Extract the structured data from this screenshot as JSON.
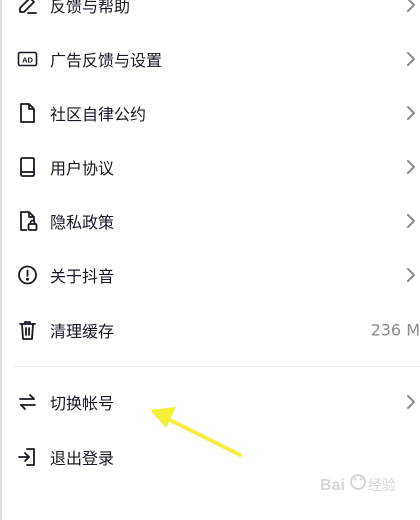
{
  "menu": {
    "items": [
      {
        "label": "反馈与帮助",
        "icon": "edit-icon"
      },
      {
        "label": "广告反馈与设置",
        "icon": "ad-icon"
      },
      {
        "label": "社区自律公约",
        "icon": "document-icon"
      },
      {
        "label": "用户协议",
        "icon": "book-icon"
      },
      {
        "label": "隐私政策",
        "icon": "lock-document-icon"
      },
      {
        "label": "关于抖音",
        "icon": "info-icon"
      },
      {
        "label": "清理缓存",
        "icon": "trash-icon",
        "value": "236 M"
      },
      {
        "label": "切换帐号",
        "icon": "switch-icon"
      },
      {
        "label": "退出登录",
        "icon": "logout-icon"
      }
    ]
  },
  "annotation": {
    "color": "#f4ef3a"
  },
  "colors": {
    "text": "#161823",
    "secondary": "#8a8b91",
    "icon": "#161823",
    "chevron": "#8a8b91"
  }
}
